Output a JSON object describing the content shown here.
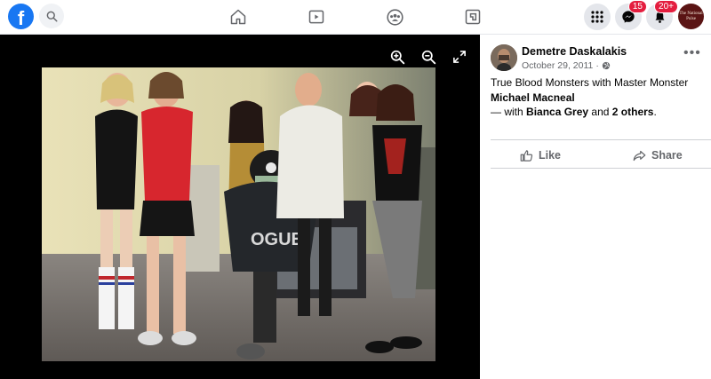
{
  "topbar": {
    "logo_letter": "f",
    "messenger_badge": "15",
    "notifications_badge": "20+",
    "profile_text": "The National Pulse"
  },
  "post": {
    "author": "Demetre Daskalakis",
    "date": "October 29, 2011",
    "caption_text": "True Blood Monsters with Master Monster",
    "caption_bold": "Michael Macneal",
    "with_prefix": "— with",
    "with_person": "Bianca Grey",
    "with_and": "and",
    "with_others": "2 others",
    "with_suffix": "."
  },
  "actions": {
    "like_label": "Like",
    "share_label": "Share"
  },
  "colors": {
    "brand": "#1877f2",
    "badge": "#e41e3f",
    "secondary_text": "#65676b"
  }
}
